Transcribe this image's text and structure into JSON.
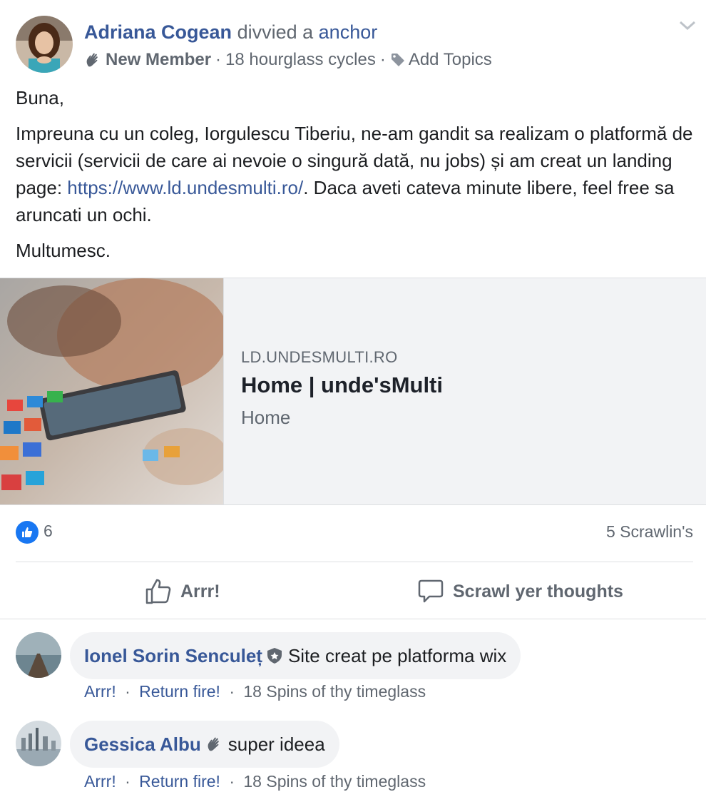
{
  "post": {
    "author": "Adriana Cogean",
    "verb": "divvied a",
    "shared_object": "anchor",
    "badge": "New Member",
    "time": "18 hourglass cycles",
    "add_topics": "Add Topics",
    "paragraphs": {
      "p1": "Buna,",
      "p2_before_link": "Impreuna cu un coleg, Iorgulescu Tiberiu, ne-am gandit sa realizam o platformă de servicii (servicii de care ai nevoie o singură dată, nu jobs) și am creat un landing page: ",
      "p2_link": "https://www.ld.undesmulti.ro/",
      "p2_after_link": ". Daca aveti cateva minute libere, feel free sa aruncati un ochi.",
      "p3": "Multumesc."
    }
  },
  "preview": {
    "domain": "LD.UNDESMULTI.RO",
    "title": "Home | unde'sMulti",
    "description": "Home"
  },
  "stats": {
    "likes": "6",
    "comments": "5 Scrawlin's"
  },
  "actions": {
    "like": "Arrr!",
    "comment": "Scrawl yer thoughts"
  },
  "comments": [
    {
      "name": "Ionel Sorin Senculeț",
      "text": "Site creat pe platforma wix",
      "like": "Arrr!",
      "reply": "Return fire!",
      "time": "18 Spins of thy timeglass"
    },
    {
      "name": "Gessica Albu",
      "text": "super ideea",
      "like": "Arrr!",
      "reply": "Return fire!",
      "time": "18 Spins of thy timeglass"
    }
  ],
  "colors": {
    "link": "#385898",
    "secondary_text": "#606770",
    "like_blue": "#1877f2",
    "bubble_bg": "#f2f3f5"
  }
}
